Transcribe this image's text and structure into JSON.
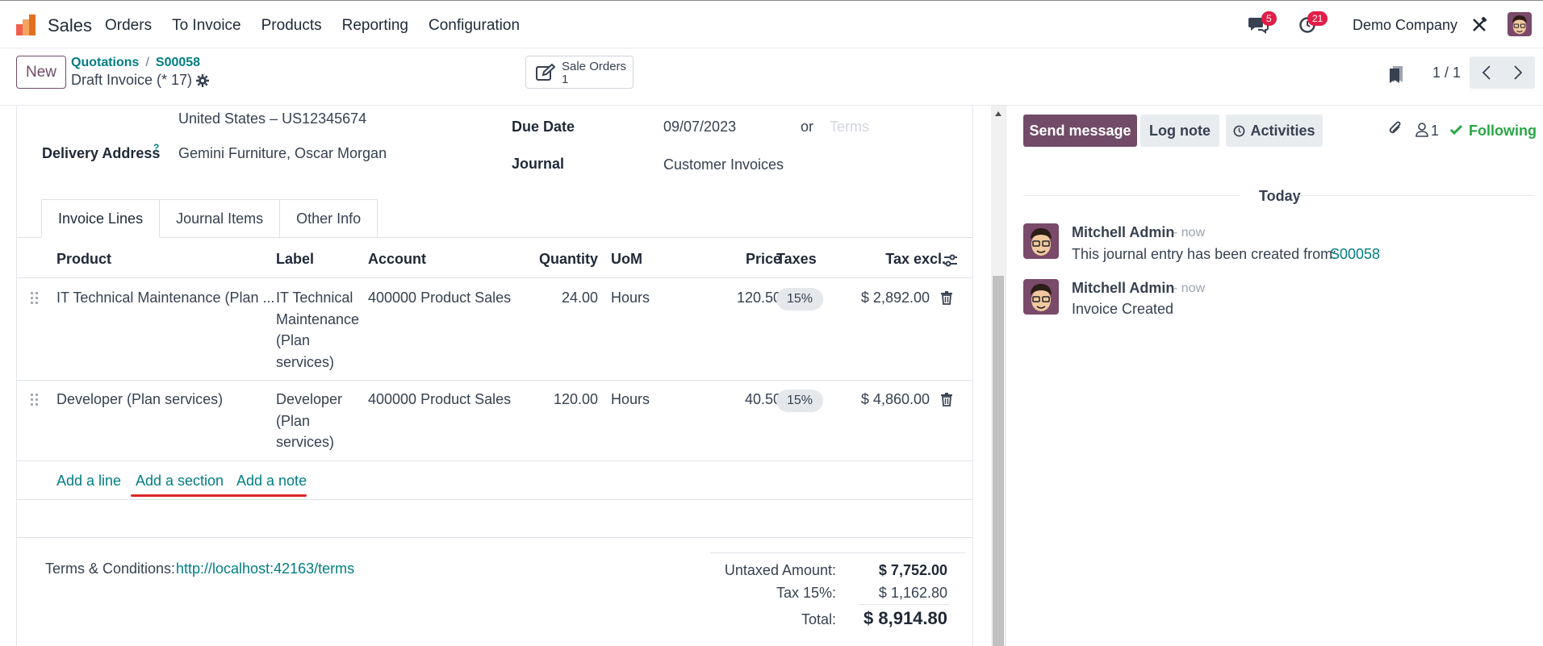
{
  "app": {
    "name": "Sales"
  },
  "menu": [
    "Orders",
    "To Invoice",
    "Products",
    "Reporting",
    "Configuration"
  ],
  "systray": {
    "messages_count": "5",
    "activities_count": "21",
    "company": "Demo Company"
  },
  "control_panel": {
    "new_label": "New",
    "breadcrumb": [
      "Quotations",
      "S00058"
    ],
    "breadcrumb_sep": "/",
    "record_title": "Draft Invoice (* 17)",
    "smart_button": {
      "label": "Sale Orders",
      "count": "1"
    },
    "pager": "1 / 1"
  },
  "form": {
    "delivery_address_top": "United States – US12345674",
    "delivery_address_label": "Delivery Address",
    "delivery_address_help": "?",
    "delivery_address_value": "Gemini Furniture, Oscar Morgan",
    "due_date_label": "Due Date",
    "due_date_value": "09/07/2023",
    "or_label": "or",
    "terms_placeholder": "Terms",
    "journal_label": "Journal",
    "journal_value": "Customer Invoices"
  },
  "tabs": [
    "Invoice Lines",
    "Journal Items",
    "Other Info"
  ],
  "table": {
    "headers": {
      "product": "Product",
      "label": "Label",
      "account": "Account",
      "quantity": "Quantity",
      "uom": "UoM",
      "price": "Price",
      "taxes": "Taxes",
      "tax_excl": "Tax excl."
    },
    "rows": [
      {
        "product": "IT Technical Maintenance (Plan ...",
        "label_lines": [
          "IT Technical",
          "Maintenance",
          "(Plan",
          "services)"
        ],
        "account": "400000 Product Sales",
        "quantity": "24.00",
        "uom": "Hours",
        "price": "120.50",
        "tax": "15%",
        "subtotal": "$ 2,892.00"
      },
      {
        "product": "Developer (Plan services)",
        "label_lines": [
          "Developer",
          "(Plan",
          "services)"
        ],
        "account": "400000 Product Sales",
        "quantity": "120.00",
        "uom": "Hours",
        "price": "40.50",
        "tax": "15%",
        "subtotal": "$ 4,860.00"
      }
    ],
    "add_line": "Add a line",
    "add_section": "Add a section",
    "add_note": "Add a note"
  },
  "footer": {
    "terms_label": "Terms & Conditions:",
    "terms_link": "http://localhost:42163/terms",
    "untaxed_label": "Untaxed Amount:",
    "untaxed_value": "$ 7,752.00",
    "tax_label": "Tax 15%:",
    "tax_value": "$ 1,162.80",
    "total_label": "Total:",
    "total_value": "$ 8,914.80"
  },
  "chatter": {
    "send_message": "Send message",
    "log_note": "Log note",
    "activities": "Activities",
    "followers_count": "1",
    "following": "Following",
    "date_separator": "Today",
    "messages": [
      {
        "author": "Mitchell Admin",
        "time": "- now",
        "body": "This journal entry has been created from:",
        "link": "S00058"
      },
      {
        "author": "Mitchell Admin",
        "time": "- now",
        "body": "Invoice Created",
        "link": ""
      }
    ]
  },
  "colors": {
    "brand": "#714b67",
    "link": "#017e84",
    "following": "#28a745",
    "badge": "#e11d48"
  }
}
